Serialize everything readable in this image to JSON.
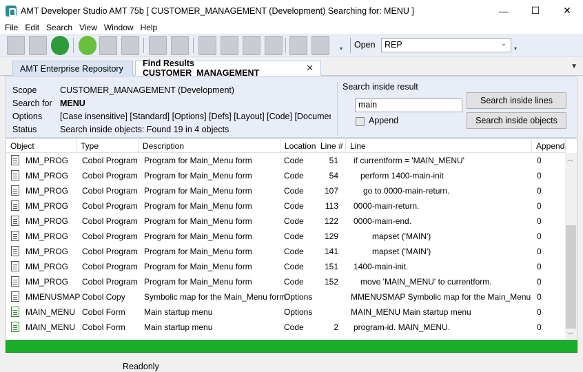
{
  "window": {
    "title": "AMT Developer Studio AMT 75b  [ CUSTOMER_MANAGEMENT (Development) Searching for: MENU ]",
    "controls": {
      "minimize": "—",
      "maximize": "☐",
      "close": "✕"
    }
  },
  "menu": [
    "File",
    "Edit",
    "Search",
    "View",
    "Window",
    "Help"
  ],
  "toolbar": {
    "icons": [
      "save-icon",
      "save-all-icon",
      "refresh-icon",
      "help-icon",
      "tools-icon",
      "print-icon",
      "tag-icon",
      "settings-folder-icon",
      "copy-icon",
      "cut-icon",
      "paste-icon",
      "screen-icon",
      "run-config-icon",
      "export-icon"
    ],
    "open_label": "Open",
    "open_value": "REP",
    "overflow": "▾"
  },
  "tabs": [
    {
      "label": "AMT Enterprise Repository",
      "active": false
    },
    {
      "label": "Find Results CUSTOMER_MANAGEMENT",
      "active": true,
      "close": "✕"
    }
  ],
  "tab_overflow": "▼",
  "info": {
    "scope_label": "Scope",
    "scope_value": "CUSTOMER_MANAGEMENT (Development)",
    "search_label": "Search for",
    "search_value": "MENU",
    "options_label": "Options",
    "options_value": "[Case insensitive] [Standard] [Options] [Defs] [Layout] [Code] [Documentation]",
    "status_label": "Status",
    "status_value": "Search inside objects: Found 19 in 4 objects"
  },
  "search_inside": {
    "title": "Search inside result",
    "input_value": "main",
    "append_label": "Append",
    "btn_lines": "Search inside lines",
    "btn_objects": "Search inside objects"
  },
  "grid": {
    "headers": [
      "Object",
      "Type",
      "Description",
      "Location",
      "Line #",
      "Line",
      "Append"
    ],
    "rows": [
      {
        "object": "MM_PROG",
        "type": "Cobol Program",
        "description": "Program for Main_Menu form",
        "location": "Code",
        "line_no": "51",
        "line": "if currentform = 'MAIN_MENU'",
        "append": "0",
        "icon": "document-icon",
        "indent": 0
      },
      {
        "object": "MM_PROG",
        "type": "Cobol Program",
        "description": "Program for Main_Menu form",
        "location": "Code",
        "line_no": "54",
        "line": "perform 1400-main-init",
        "append": "0",
        "icon": "document-icon",
        "indent": 10
      },
      {
        "object": "MM_PROG",
        "type": "Cobol Program",
        "description": "Program for Main_Menu form",
        "location": "Code",
        "line_no": "107",
        "line": "go to 0000-main-return.",
        "append": "0",
        "icon": "document-icon",
        "indent": 14
      },
      {
        "object": "MM_PROG",
        "type": "Cobol Program",
        "description": "Program for Main_Menu form",
        "location": "Code",
        "line_no": "113",
        "line": "0000-main-return.",
        "append": "0",
        "icon": "document-icon",
        "indent": 0
      },
      {
        "object": "MM_PROG",
        "type": "Cobol Program",
        "description": "Program for Main_Menu form",
        "location": "Code",
        "line_no": "122",
        "line": "0000-main-end.",
        "append": "0",
        "icon": "document-icon",
        "indent": 0
      },
      {
        "object": "MM_PROG",
        "type": "Cobol Program",
        "description": "Program for Main_Menu form",
        "location": "Code",
        "line_no": "129",
        "line": "mapset ('MAIN')",
        "append": "0",
        "icon": "document-icon",
        "indent": 27
      },
      {
        "object": "MM_PROG",
        "type": "Cobol Program",
        "description": "Program for Main_Menu form",
        "location": "Code",
        "line_no": "141",
        "line": "mapset ('MAIN')",
        "append": "0",
        "icon": "document-icon",
        "indent": 27
      },
      {
        "object": "MM_PROG",
        "type": "Cobol Program",
        "description": "Program for Main_Menu form",
        "location": "Code",
        "line_no": "151",
        "line": "1400-main-init.",
        "append": "0",
        "icon": "document-icon",
        "indent": 0
      },
      {
        "object": "MM_PROG",
        "type": "Cobol Program",
        "description": "Program for Main_Menu form",
        "location": "Code",
        "line_no": "152",
        "line": "move 'MAIN_MENU' to currentform.",
        "append": "0",
        "icon": "document-icon",
        "indent": 10
      },
      {
        "object": "MMENUSMAP",
        "type": "Cobol Copy",
        "description": "Symbolic map for the Main_Menu form",
        "location": "Options",
        "line_no": "",
        "line": "MMENUSMAP Symbolic map for the Main_Menu form",
        "append": "0",
        "icon": "copy-document-icon",
        "indent": -4
      },
      {
        "object": "MAIN_MENU",
        "type": "Cobol Form",
        "description": "Main startup menu",
        "location": "Options",
        "line_no": "",
        "line": "MAIN_MENU Main startup menu",
        "append": "0",
        "icon": "form-icon",
        "indent": -4
      },
      {
        "object": "MAIN_MENU",
        "type": "Cobol Form",
        "description": "Main startup menu",
        "location": "Code",
        "line_no": "2",
        "line": "program-id. MAIN_MENU.",
        "append": "0",
        "icon": "form-icon",
        "indent": 0
      }
    ]
  },
  "status": {
    "text": "Readonly"
  },
  "colors": {
    "progress": "#1aad2a",
    "panel": "#e9edf7",
    "toolbar": "#e9edf5"
  }
}
